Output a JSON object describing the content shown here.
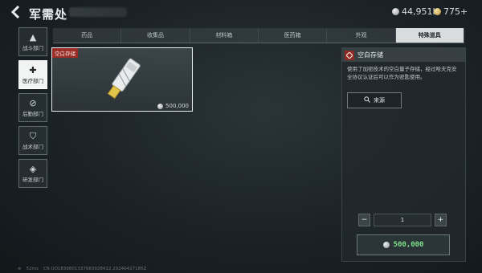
{
  "header": {
    "title": "军需处",
    "currency": [
      {
        "icon": "silver-coin-icon",
        "value": "44,951K"
      },
      {
        "icon": "gold-coin-icon",
        "value": "775+"
      }
    ]
  },
  "sidebar": {
    "items": [
      {
        "label": "战斗部门",
        "icon": "combat-icon",
        "active": false
      },
      {
        "label": "医疗部门",
        "icon": "medical-cross-icon",
        "active": true
      },
      {
        "label": "后勤部门",
        "icon": "logistics-icon",
        "active": false
      },
      {
        "label": "战术部门",
        "icon": "shield-icon",
        "active": false
      },
      {
        "label": "研发部门",
        "icon": "research-icon",
        "active": false
      }
    ]
  },
  "tabs": [
    {
      "label": "药品",
      "active": false
    },
    {
      "label": "收集品",
      "active": false
    },
    {
      "label": "材料箱",
      "active": false
    },
    {
      "label": "医药箱",
      "active": false
    },
    {
      "label": "外观",
      "active": false
    },
    {
      "label": "特殊道具",
      "active": true
    }
  ],
  "item_card": {
    "tag": "空白存储",
    "price": "500,000"
  },
  "detail": {
    "title": "空白存储",
    "description": "使用了加密技术的空白量子存储，经过哈夫克安全协议认证后可以作为密匙使用。",
    "source_button": "来源",
    "quantity": "1",
    "buy_price": "500,000"
  },
  "footer": {
    "ping": "52ms",
    "build": "CN UO1839801337683928412.20240427185Z"
  },
  "colors": {
    "accent_red": "#9a2c26",
    "price_green": "#7fe08a"
  }
}
